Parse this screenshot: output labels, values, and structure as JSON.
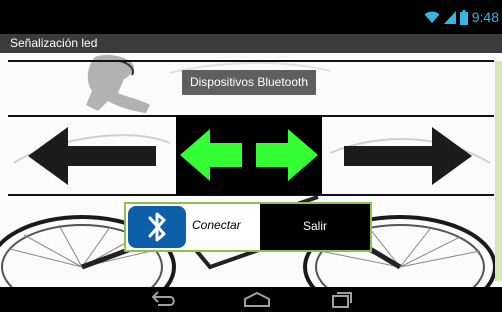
{
  "status_bar": {
    "time": "9:48",
    "icons": [
      "wifi-icon",
      "signal-icon",
      "battery-icon"
    ],
    "accent_color": "#35b6e3"
  },
  "app": {
    "title": "Señalización led"
  },
  "toast": {
    "text": "Dispositivos Bluetooth"
  },
  "controls": {
    "left_arrow_icon": "arrow-left-icon",
    "right_arrow_icon": "arrow-right-icon",
    "led_indicator_icons": [
      "green-arrow-left-icon",
      "green-arrow-right-icon"
    ],
    "led_color": "#33ff33"
  },
  "buttons": {
    "connect_label": "Conectar",
    "connect_icon": "bluetooth-icon",
    "exit_label": "Salir",
    "border_color": "#8bc34a"
  },
  "nav_bar": {
    "icons": [
      "back-icon",
      "home-icon",
      "recents-icon"
    ]
  }
}
